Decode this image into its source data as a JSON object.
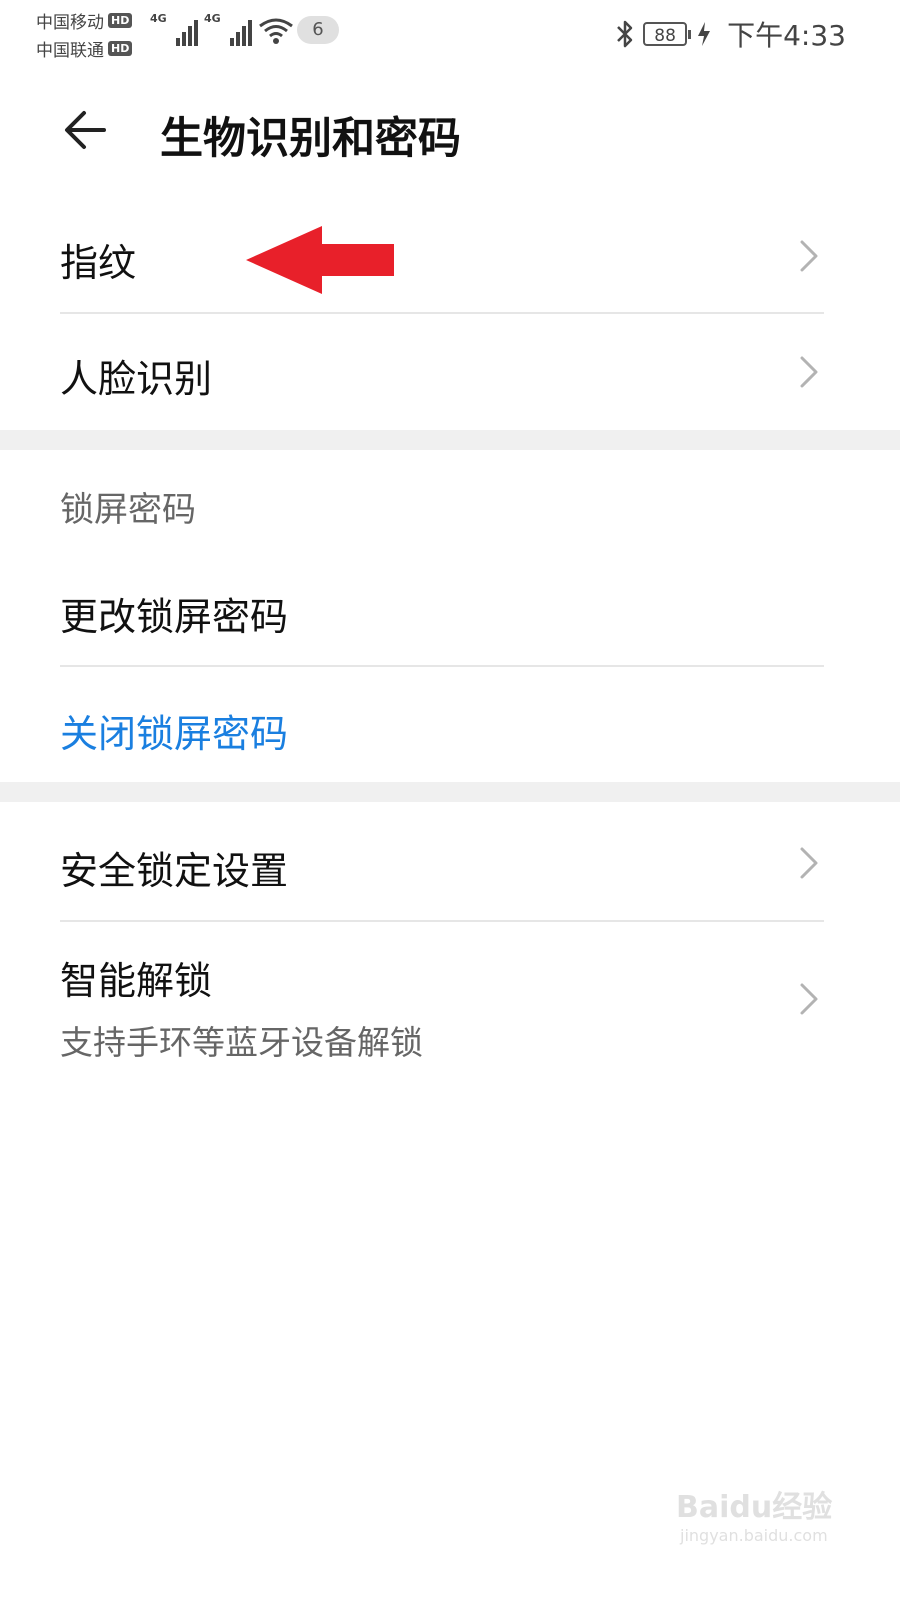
{
  "status_bar": {
    "carrier1": "中国移动",
    "carrier2": "中国联通",
    "hd_label": "HD",
    "network1": "4G",
    "network2": "4G",
    "notification_count": "6",
    "battery": "88",
    "time": "下午4:33"
  },
  "header": {
    "title": "生物识别和密码"
  },
  "biometrics": {
    "fingerprint": "指纹",
    "face": "人脸识别"
  },
  "lock_screen": {
    "section_title": "锁屏密码",
    "change": "更改锁屏密码",
    "disable": "关闭锁屏密码"
  },
  "security": {
    "lock_settings": "安全锁定设置",
    "smart_unlock": "智能解锁",
    "smart_unlock_sub": "支持手环等蓝牙设备解锁"
  },
  "watermark": {
    "brand": "Baidu经验",
    "url": "jingyan.baidu.com"
  },
  "colors": {
    "accent_blue": "#1a7fe0",
    "annotation_arrow": "#e8202a"
  }
}
